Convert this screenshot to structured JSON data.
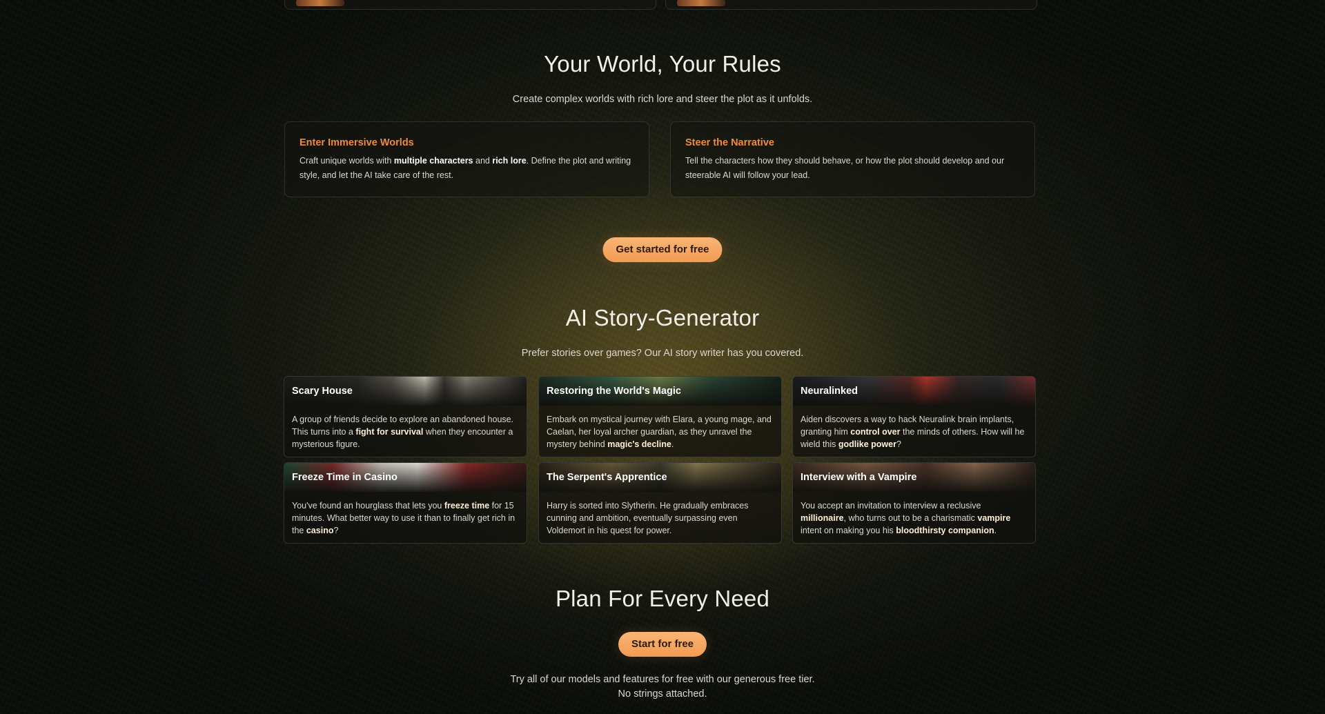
{
  "worlds": {
    "title": "Your World, Your Rules",
    "subtitle": "Create complex worlds with rich lore and steer the plot as it unfolds.",
    "cards": [
      {
        "title": "Enter Immersive Worlds",
        "body": [
          {
            "t": "Craft unique worlds with "
          },
          {
            "t": "multiple characters",
            "b": true
          },
          {
            "t": " and "
          },
          {
            "t": "rich lore",
            "b": true
          },
          {
            "t": ". Define the plot and writing style, and let the AI take care of the rest."
          }
        ]
      },
      {
        "title": "Steer the Narrative",
        "body": [
          {
            "t": "Tell the characters how they should behave, or how the plot should develop and our steerable AI will follow your lead."
          }
        ]
      }
    ],
    "cta_label": "Get started for free"
  },
  "stories": {
    "title": "AI Story-Generator",
    "subtitle": "Prefer stories over games? Our AI story writer has you covered.",
    "items": [
      {
        "title": "Scary House",
        "body": [
          {
            "t": "A group of friends decide to explore an abandoned house. This turns into a "
          },
          {
            "t": "fight for survival",
            "b": true
          },
          {
            "t": " when they encounter a mysterious figure."
          }
        ]
      },
      {
        "title": "Restoring the World's Magic",
        "body": [
          {
            "t": "Embark on mystical journey with Elara, a young mage, and Caelan, her loyal archer guardian, as they unravel the mystery behind "
          },
          {
            "t": "magic's decline",
            "b": true
          },
          {
            "t": "."
          }
        ]
      },
      {
        "title": "Neuralinked",
        "body": [
          {
            "t": "Aiden discovers a way to hack Neuralink brain implants, granting him "
          },
          {
            "t": "control over",
            "b": true
          },
          {
            "t": " the minds of others. How will he wield this "
          },
          {
            "t": "godlike power",
            "b": true
          },
          {
            "t": "?"
          }
        ]
      },
      {
        "title": "Freeze Time in Casino",
        "body": [
          {
            "t": "You've found an hourglass that lets you "
          },
          {
            "t": "freeze time",
            "b": true
          },
          {
            "t": " for 15 minutes. What better way to use it than to finally get rich in the "
          },
          {
            "t": "casino",
            "b": true
          },
          {
            "t": "?"
          }
        ]
      },
      {
        "title": "The Serpent's Apprentice",
        "body": [
          {
            "t": "Harry is sorted into Slytherin. He gradually embraces cunning and ambition, eventually surpassing even Voldemort in his quest for power."
          }
        ]
      },
      {
        "title": "Interview with a Vampire",
        "body": [
          {
            "t": "You accept an invitation to interview a reclusive "
          },
          {
            "t": "millionaire",
            "b": true
          },
          {
            "t": ", who turns out to be a charismatic "
          },
          {
            "t": "vampire",
            "b": true
          },
          {
            "t": " intent on making you his "
          },
          {
            "t": "bloodthirsty companion",
            "b": true
          },
          {
            "t": "."
          }
        ]
      }
    ]
  },
  "plans": {
    "title": "Plan For Every Need",
    "cta_label": "Start for free",
    "line1": "Try all of our models and features for free with our generous free tier.",
    "line2": "No strings attached."
  },
  "colors": {
    "accent": "#f08a3c",
    "cta": "#f6a862"
  }
}
